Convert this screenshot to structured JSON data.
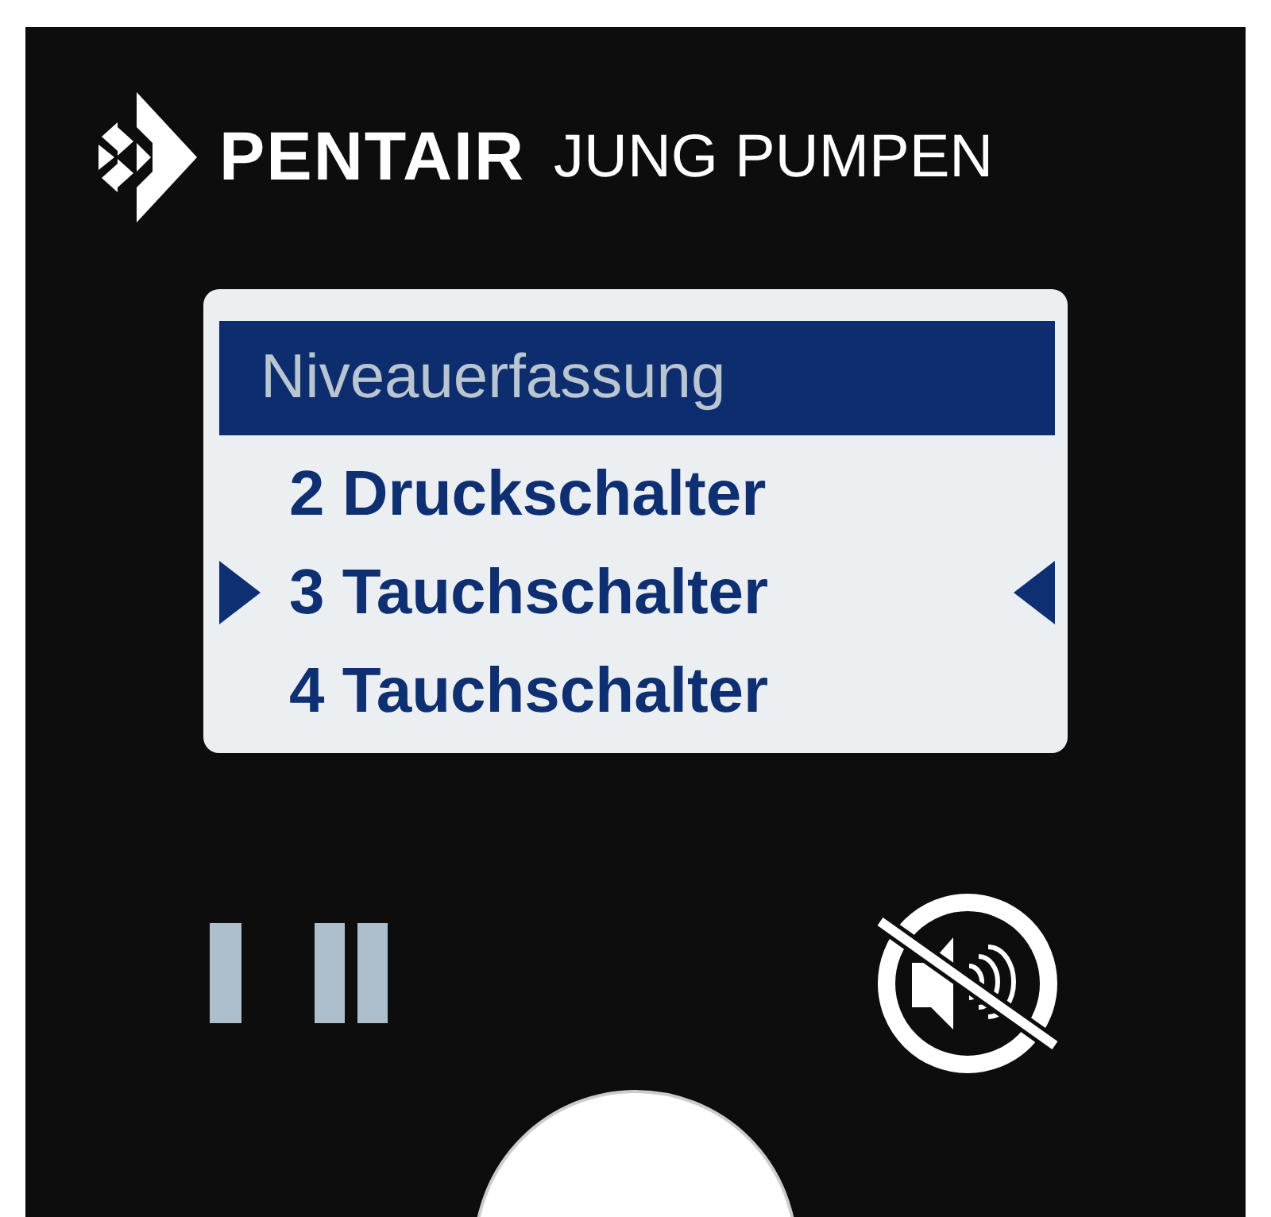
{
  "brand": {
    "name": "PENTAIR",
    "subtitle": "JUNG PUMPEN"
  },
  "display": {
    "title": "Niveauerfassung",
    "items": [
      {
        "label": "2 Druckschalter",
        "selected": false
      },
      {
        "label": "3 Tauchschalter",
        "selected": true
      },
      {
        "label": "4 Tauchschalter",
        "selected": false
      }
    ]
  }
}
